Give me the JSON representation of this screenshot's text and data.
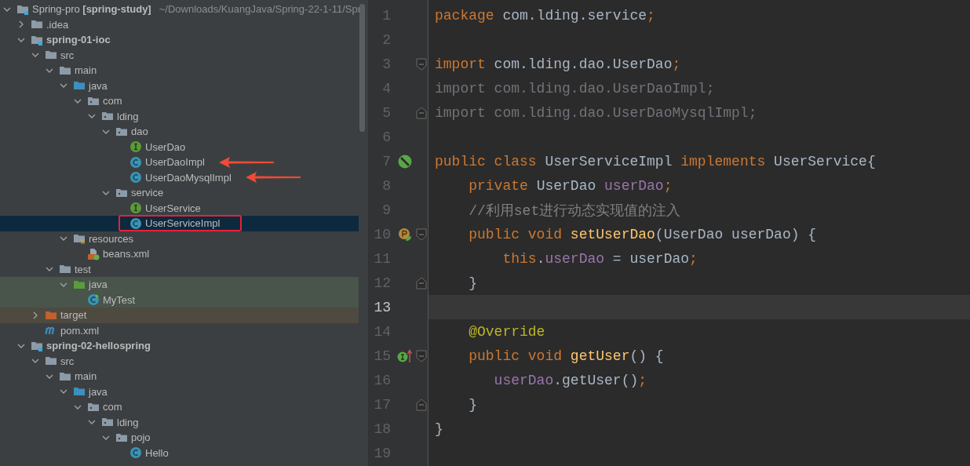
{
  "project_tree": {
    "nodes": [
      {
        "label": "Spring-pro **[spring-study]**",
        "detail": "~/Downloads/KuangJava/Spring-22-1-11/Spr",
        "kind": "module-root",
        "expanded": true,
        "selected": false,
        "children": [
          {
            "label": ".idea",
            "kind": "folder",
            "expanded": false,
            "selected": false
          },
          {
            "label": "spring-01-ioc",
            "kind": "module",
            "expanded": true,
            "selected": false,
            "children": [
              {
                "label": "src",
                "kind": "folder",
                "expanded": true,
                "selected": false,
                "children": [
                  {
                    "label": "main",
                    "kind": "folder",
                    "expanded": true,
                    "selected": false,
                    "children": [
                      {
                        "label": "java",
                        "kind": "source-folder",
                        "expanded": true,
                        "selected": false,
                        "children": [
                          {
                            "label": "com",
                            "kind": "package",
                            "expanded": true,
                            "selected": false,
                            "children": [
                              {
                                "label": "lding",
                                "kind": "package",
                                "expanded": true,
                                "selected": false,
                                "children": [
                                  {
                                    "label": "dao",
                                    "kind": "package",
                                    "expanded": true,
                                    "selected": false,
                                    "children": [
                                      {
                                        "label": "UserDao",
                                        "kind": "interface",
                                        "selected": false,
                                        "arrow": false,
                                        "boxed": false
                                      },
                                      {
                                        "label": "UserDaoImpl",
                                        "kind": "class",
                                        "selected": false,
                                        "arrow": true,
                                        "boxed": false
                                      },
                                      {
                                        "label": "UserDaoMysqlImpl",
                                        "kind": "class",
                                        "selected": false,
                                        "arrow": true,
                                        "boxed": false
                                      }
                                    ]
                                  },
                                  {
                                    "label": "service",
                                    "kind": "package",
                                    "expanded": true,
                                    "selected": false,
                                    "children": [
                                      {
                                        "label": "UserService",
                                        "kind": "interface",
                                        "selected": false,
                                        "arrow": false,
                                        "boxed": false
                                      },
                                      {
                                        "label": "UserServiceImpl",
                                        "kind": "class",
                                        "selected": true,
                                        "arrow": false,
                                        "boxed": true
                                      }
                                    ]
                                  }
                                ]
                              }
                            ]
                          }
                        ]
                      },
                      {
                        "label": "resources",
                        "kind": "resources-folder",
                        "expanded": true,
                        "selected": false,
                        "children": [
                          {
                            "label": "beans.xml",
                            "kind": "xml",
                            "selected": false
                          }
                        ]
                      }
                    ]
                  },
                  {
                    "label": "test",
                    "kind": "folder",
                    "expanded": true,
                    "selected": false,
                    "children": [
                      {
                        "label": "java",
                        "kind": "test-folder",
                        "expanded": true,
                        "selected": false,
                        "children": [
                          {
                            "label": "MyTest",
                            "kind": "test-class",
                            "selected": false
                          }
                        ]
                      }
                    ]
                  }
                ]
              },
              {
                "label": "target",
                "kind": "excluded-folder",
                "expanded": false,
                "selected": false
              },
              {
                "label": "pom.xml",
                "kind": "maven",
                "selected": false
              }
            ]
          },
          {
            "label": "spring-02-hellospring",
            "kind": "module",
            "expanded": true,
            "selected": false,
            "children": [
              {
                "label": "src",
                "kind": "folder",
                "expanded": true,
                "selected": false,
                "children": [
                  {
                    "label": "main",
                    "kind": "folder",
                    "expanded": true,
                    "selected": false,
                    "children": [
                      {
                        "label": "java",
                        "kind": "source-folder",
                        "expanded": true,
                        "selected": false,
                        "children": [
                          {
                            "label": "com",
                            "kind": "package",
                            "expanded": true,
                            "selected": false,
                            "children": [
                              {
                                "label": "lding",
                                "kind": "package",
                                "expanded": true,
                                "selected": false,
                                "children": [
                                  {
                                    "label": "pojo",
                                    "kind": "package",
                                    "expanded": true,
                                    "selected": false,
                                    "children": [
                                      {
                                        "label": "Hello",
                                        "kind": "class",
                                        "selected": false
                                      }
                                    ]
                                  }
                                ]
                              }
                            ]
                          }
                        ]
                      }
                    ]
                  }
                ]
              }
            ]
          }
        ]
      }
    ]
  },
  "editor": {
    "lines": [
      {
        "number": "1",
        "current": false,
        "tokens": [
          {
            "t": "package",
            "kind": "keyword"
          },
          {
            "t": " com.lding.service",
            "kind": "plain"
          },
          {
            "t": ";",
            "kind": "keyword"
          }
        ]
      },
      {
        "number": "2",
        "current": false
      },
      {
        "number": "3",
        "current": false,
        "fold": {
          "kind": "start"
        },
        "tokens": [
          {
            "t": "import",
            "kind": "keyword"
          },
          {
            "t": " com.lding.dao.UserDao",
            "kind": "plain"
          },
          {
            "t": ";",
            "kind": "keyword"
          }
        ]
      },
      {
        "number": "4",
        "current": false,
        "tokens": [
          {
            "t": "import com.lding.dao.UserDaoImpl;",
            "kind": "unused"
          }
        ]
      },
      {
        "number": "5",
        "current": false,
        "fold": {
          "kind": "end"
        },
        "tokens": [
          {
            "t": "import com.lding.dao.UserDaoMysqlImpl;",
            "kind": "unused"
          }
        ]
      },
      {
        "number": "6",
        "current": false
      },
      {
        "number": "7",
        "current": false,
        "marker": {
          "kind": "bean"
        },
        "tokens": [
          {
            "t": "public class",
            "kind": "keyword"
          },
          {
            "t": " UserServiceImpl ",
            "kind": "plain"
          },
          {
            "t": "implements",
            "kind": "keyword"
          },
          {
            "t": " UserService{",
            "kind": "plain"
          }
        ]
      },
      {
        "number": "8",
        "current": false,
        "tokens": [
          {
            "t": "    private",
            "kind": "keyword"
          },
          {
            "t": " UserDao ",
            "kind": "plain"
          },
          {
            "t": "userDao",
            "kind": "field"
          },
          {
            "t": ";",
            "kind": "keyword"
          }
        ]
      },
      {
        "number": "9",
        "current": false,
        "tokens": [
          {
            "t": "    //利用set进行动态实现值的注入",
            "kind": "comment"
          }
        ]
      },
      {
        "number": "10",
        "current": false,
        "marker": {
          "kind": "property"
        },
        "fold": {
          "kind": "start"
        },
        "tokens": [
          {
            "t": "    public void ",
            "kind": "keyword"
          },
          {
            "t": "setUserDao",
            "kind": "method"
          },
          {
            "t": "(UserDao userDao) {",
            "kind": "plain"
          }
        ]
      },
      {
        "number": "11",
        "current": false,
        "tokens": [
          {
            "t": "        this",
            "kind": "keyword"
          },
          {
            "t": ".",
            "kind": "plain"
          },
          {
            "t": "userDao",
            "kind": "field"
          },
          {
            "t": " = userDao",
            "kind": "plain"
          },
          {
            "t": ";",
            "kind": "keyword"
          }
        ]
      },
      {
        "number": "12",
        "current": false,
        "fold": {
          "kind": "end"
        },
        "tokens": [
          {
            "t": "    }",
            "kind": "plain"
          }
        ]
      },
      {
        "number": "13",
        "current": true
      },
      {
        "number": "14",
        "current": false,
        "tokens": [
          {
            "t": "    @Override",
            "kind": "annotation"
          }
        ]
      },
      {
        "number": "15",
        "current": false,
        "marker": {
          "kind": "implements"
        },
        "fold": {
          "kind": "start"
        },
        "tokens": [
          {
            "t": "    public void ",
            "kind": "keyword"
          },
          {
            "t": "getUser",
            "kind": "method"
          },
          {
            "t": "() {",
            "kind": "plain"
          }
        ]
      },
      {
        "number": "16",
        "current": false,
        "tokens": [
          {
            "t": "       userDao",
            "kind": "field"
          },
          {
            "t": ".getUser()",
            "kind": "plain"
          },
          {
            "t": ";",
            "kind": "keyword"
          }
        ]
      },
      {
        "number": "17",
        "current": false,
        "fold": {
          "kind": "end"
        },
        "tokens": [
          {
            "t": "    }",
            "kind": "plain"
          }
        ]
      },
      {
        "number": "18",
        "current": false,
        "tokens": [
          {
            "t": "}",
            "kind": "plain"
          }
        ]
      },
      {
        "number": "19",
        "current": false
      }
    ]
  }
}
